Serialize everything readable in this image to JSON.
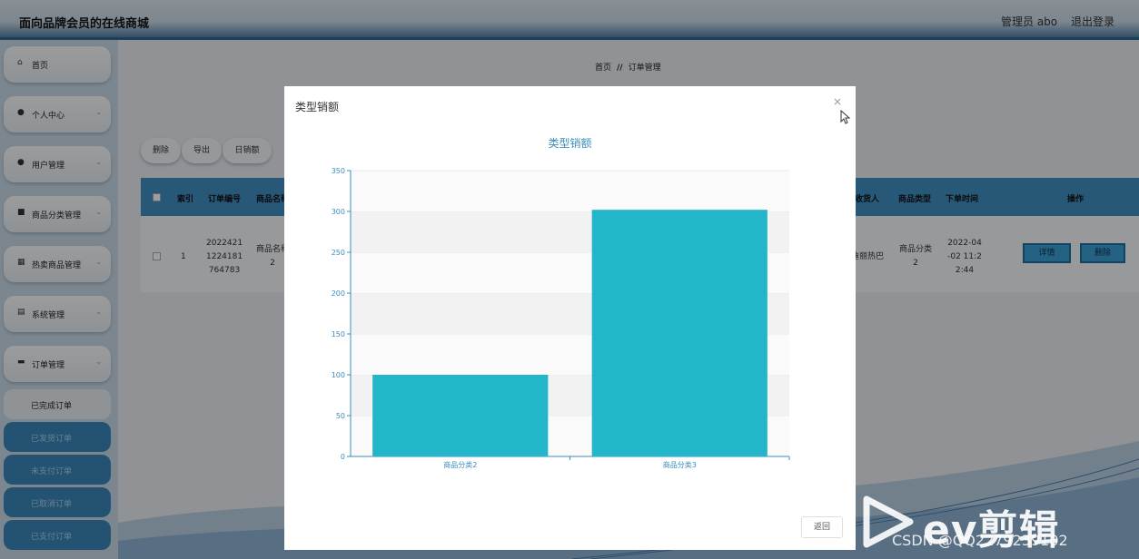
{
  "header": {
    "site_title": "面向品牌会员的在线商城",
    "admin_label": "管理员 abo",
    "logout_label": "退出登录"
  },
  "sidebar": {
    "menu": [
      {
        "label": "首页",
        "icon": "home-icon"
      },
      {
        "label": "个人中心",
        "icon": "user-icon"
      },
      {
        "label": "用户管理",
        "icon": "user-icon"
      },
      {
        "label": "商品分类管理",
        "icon": "briefcase-icon"
      },
      {
        "label": "热卖商品管理",
        "icon": "grid-icon"
      },
      {
        "label": "系统管理",
        "icon": "clipboard-icon"
      },
      {
        "label": "订单管理",
        "icon": "ticket-icon"
      }
    ],
    "submenu": [
      "已完成订单",
      "已发货订单",
      "未支付订单",
      "已取消订单",
      "已支付订单"
    ]
  },
  "breadcrumb": {
    "home": "首页",
    "separator": "//",
    "current": "订单管理"
  },
  "toolbar": {
    "delete": "删除",
    "export": "导出",
    "daily_sales": "日销额"
  },
  "table": {
    "headers": {
      "index": "索引",
      "order_no": "订单编号",
      "product_name": "商品名称",
      "consignee": "收货人",
      "category": "商品类型",
      "order_time": "下单时间",
      "actions": "操作"
    },
    "row": {
      "index": "1",
      "order_no": [
        "2022421",
        "1224181",
        "764783"
      ],
      "product_name": [
        "商品名称",
        "2"
      ],
      "consignee": "迪丽热巴",
      "category": [
        "商品分类",
        "2"
      ],
      "order_time": [
        "2022-04",
        "-02 11:2",
        "2:44"
      ],
      "detail_btn": "详情",
      "delete_btn": "删除"
    }
  },
  "modal": {
    "title": "类型销额",
    "close_symbol": "×",
    "return_label": "返回"
  },
  "chart_data": {
    "type": "bar",
    "title": "类型销额",
    "categories": [
      "商品分类2",
      "商品分类3"
    ],
    "values": [
      100,
      302
    ],
    "ylim": [
      0,
      350
    ],
    "yticks": [
      0,
      50,
      100,
      150,
      200,
      250,
      300,
      350
    ],
    "xlabel": "",
    "ylabel": "",
    "bar_color": "#23b5c9",
    "axis_color": "#3c8dbc",
    "title_color": "#3c8dbc",
    "grid": "alternating bands"
  },
  "watermark": {
    "brand": "ev剪辑",
    "csdn": "CSDN @QQ2279239102"
  }
}
